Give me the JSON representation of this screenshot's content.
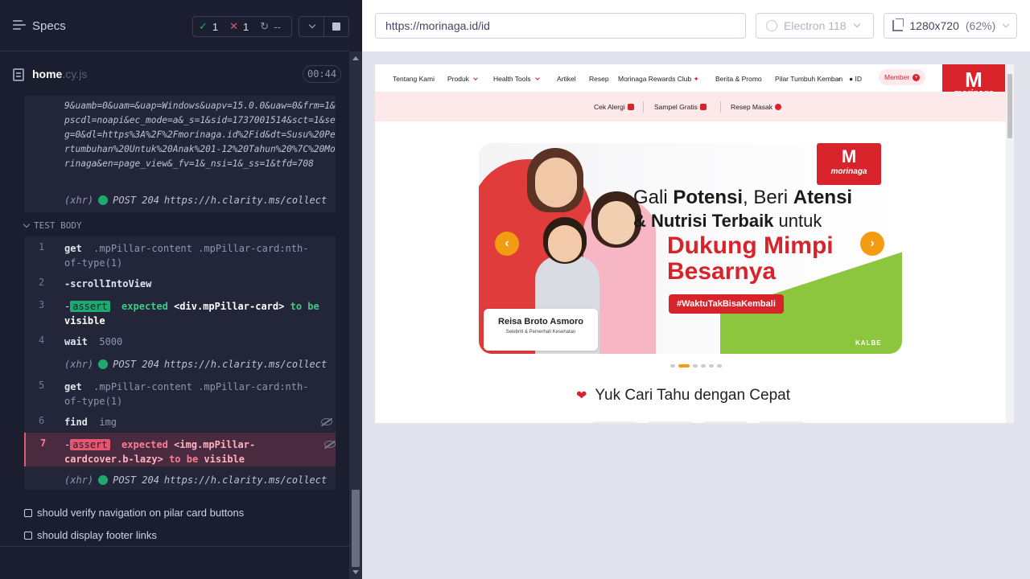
{
  "runner": {
    "specs_label": "Specs",
    "stats": {
      "passed": "1",
      "failed": "1",
      "pending": "--"
    },
    "file": {
      "name": "home",
      "ext": ".cy.js",
      "timer": "00:44"
    },
    "url_log_text": "9&uamb=0&uam=&uap=Windows&uapv=15.0.0&uaw=0&frm=1&pscdl=noapi&ec_mode=a&_s=1&sid=1737001514&sct=1&seg=0&dl=https%3A%2F%2Fmorinaga.id%2Fid&dt=Susu%20Pertumbuhan%20Untuk%20Anak%201-12%20Tahun%20%7C%20Morinaga&en=page_view&_fv=1&_nsi=1&_ss=1&tfd=708",
    "xhr": {
      "label": "(xhr)",
      "method": "POST 204",
      "url": "https://h.clarity.ms/collect"
    },
    "test_body_label": "TEST BODY",
    "commands": [
      {
        "num": "1",
        "name": "get",
        "args": ".mpPillar-content .mpPillar-card:nth-of-type(1)"
      },
      {
        "num": "2",
        "name": "-scrollIntoView",
        "args": ""
      },
      {
        "num": "3",
        "badge": "assert",
        "expected": "expected",
        "subject": "<div.mpPillar-card>",
        "to_be": "to be",
        "state": "visible"
      },
      {
        "num": "4",
        "name": "wait",
        "args": "5000"
      },
      {
        "num": "5",
        "name": "get",
        "args": ".mpPillar-content .mpPillar-card:nth-of-type(1)"
      },
      {
        "num": "6",
        "name": "find",
        "args": "img"
      },
      {
        "num": "7",
        "badge": "assert",
        "expected": "expected",
        "subject": "<img.mpPillar-cardcover.b-lazy>",
        "to_be": "to be",
        "state": "visible"
      }
    ],
    "tests": [
      "should verify navigation on pilar card buttons",
      "should display footer links"
    ]
  },
  "browser": {
    "url": "https://morinaga.id/id",
    "browser_name": "Electron 118",
    "viewport": "1280x720",
    "zoom": "(62%)"
  },
  "site": {
    "nav": [
      "Tentang Kami",
      "Produk",
      "Health Tools",
      "Artikel",
      "Resep",
      "Morinaga Rewards Club",
      "Berita & Promo",
      "Pilar Tumbuh Kemban",
      "ID"
    ],
    "member": "Member",
    "logo_text": "morinaga",
    "quick_links": [
      "Cek Alergi",
      "Sampel Gratis",
      "Resep Masak"
    ],
    "banner": {
      "line1_a": "Gali ",
      "line1_b": "Potensi",
      "line1_c": ", Beri ",
      "line1_d": "Atensi",
      "line2_a": "& Nutrisi Terbaik",
      "line2_b": " untuk",
      "line3": "Dukung Mimpi Besarnya",
      "hashtag": "#WaktuTakBisaKembali",
      "caption_name": "Reisa Broto Asmoro",
      "caption_role": "Selebriti & Pemerhati Kesehatan",
      "kalbe": "KALBE",
      "prev": "‹",
      "next": "›"
    },
    "quick_title": "Yuk Cari Tahu dengan Cepat"
  },
  "colors": {
    "pass": "#1fa971",
    "fail": "#e45770",
    "brand_red": "#d8232a",
    "accent_orange": "#f39c12"
  }
}
